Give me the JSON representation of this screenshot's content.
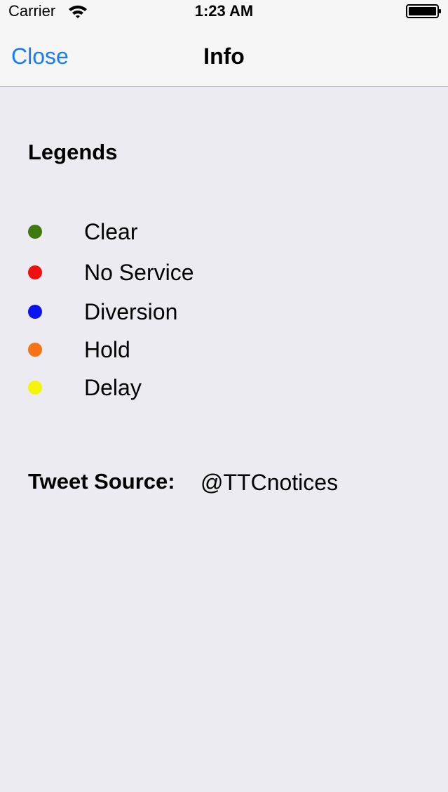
{
  "status_bar": {
    "carrier": "Carrier",
    "time": "1:23 AM",
    "wifi_icon": "wifi-icon",
    "battery_icon": "battery-icon"
  },
  "nav": {
    "close_label": "Close",
    "title": "Info"
  },
  "legends": {
    "heading": "Legends",
    "items": [
      {
        "label": "Clear",
        "color": "#3f7a10"
      },
      {
        "label": "No Service",
        "color": "#f01010"
      },
      {
        "label": "Diversion",
        "color": "#0a14f0"
      },
      {
        "label": "Hold",
        "color": "#f57314"
      },
      {
        "label": "Delay",
        "color": "#f5f50a"
      }
    ]
  },
  "tweet_source": {
    "label": "Tweet Source:",
    "value": "@TTCnotices"
  }
}
